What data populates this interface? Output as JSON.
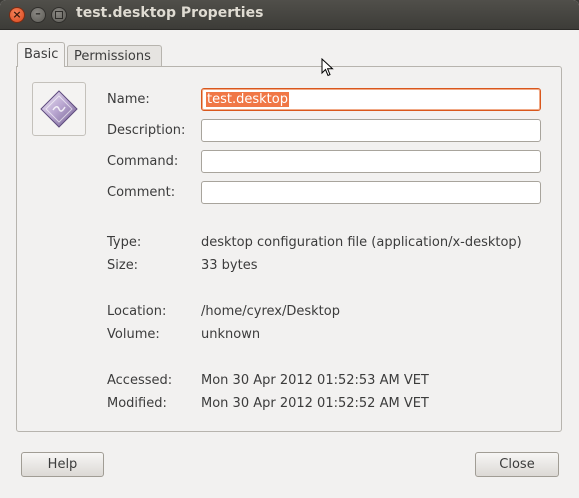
{
  "window": {
    "title": "test.desktop Properties",
    "controls": {
      "close": "×",
      "minimize": "–"
    }
  },
  "tabs": [
    {
      "label": "Basic",
      "active": true
    },
    {
      "label": "Permissions",
      "active": false
    }
  ],
  "icon": "desktop-file-icon",
  "form": {
    "name_label": "Name:",
    "name_value": "test.desktop",
    "description_label": "Description:",
    "description_value": "",
    "command_label": "Command:",
    "command_value": "",
    "comment_label": "Comment:",
    "comment_value": ""
  },
  "info": {
    "type_label": "Type:",
    "type_value": "desktop configuration file (application/x-desktop)",
    "size_label": "Size:",
    "size_value": "33 bytes",
    "location_label": "Location:",
    "location_value": "/home/cyrex/Desktop",
    "volume_label": "Volume:",
    "volume_value": "unknown",
    "accessed_label": "Accessed:",
    "accessed_value": "Mon 30 Apr 2012 01:52:53 AM VET",
    "modified_label": "Modified:",
    "modified_value": "Mon 30 Apr 2012 01:52:52 AM VET"
  },
  "buttons": {
    "help": "Help",
    "close": "Close"
  },
  "colors": {
    "selection": "#f07746",
    "focus_border": "#d9571c",
    "titlebar": "#3d3c38"
  }
}
